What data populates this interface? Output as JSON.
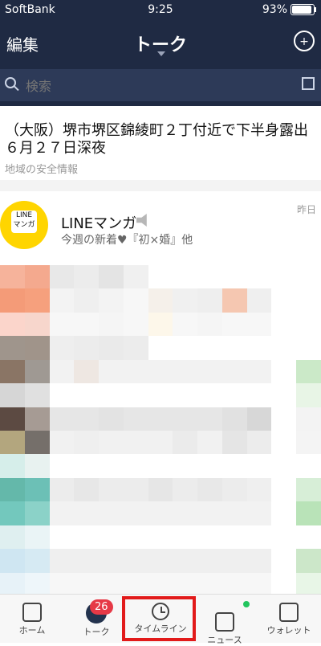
{
  "status": {
    "carrier": "SoftBank",
    "time": "9:25",
    "battery": "93%"
  },
  "header": {
    "edit_label": "編集",
    "title": "トーク"
  },
  "search": {
    "placeholder": "検索"
  },
  "news": {
    "title": "（大阪）堺市堺区錦綾町２丁付近で下半身露出　６月２７日深夜",
    "source": "地域の安全情報"
  },
  "chat": {
    "name": "LINEマンガ",
    "preview": "今週の新着♥『初×婚』他",
    "time": "昨日"
  },
  "tabs": {
    "home": "ホーム",
    "talk": "トーク",
    "talk_badge": "26",
    "timeline": "タイムライン",
    "news": "ニュース",
    "wallet": "ウォレット"
  }
}
